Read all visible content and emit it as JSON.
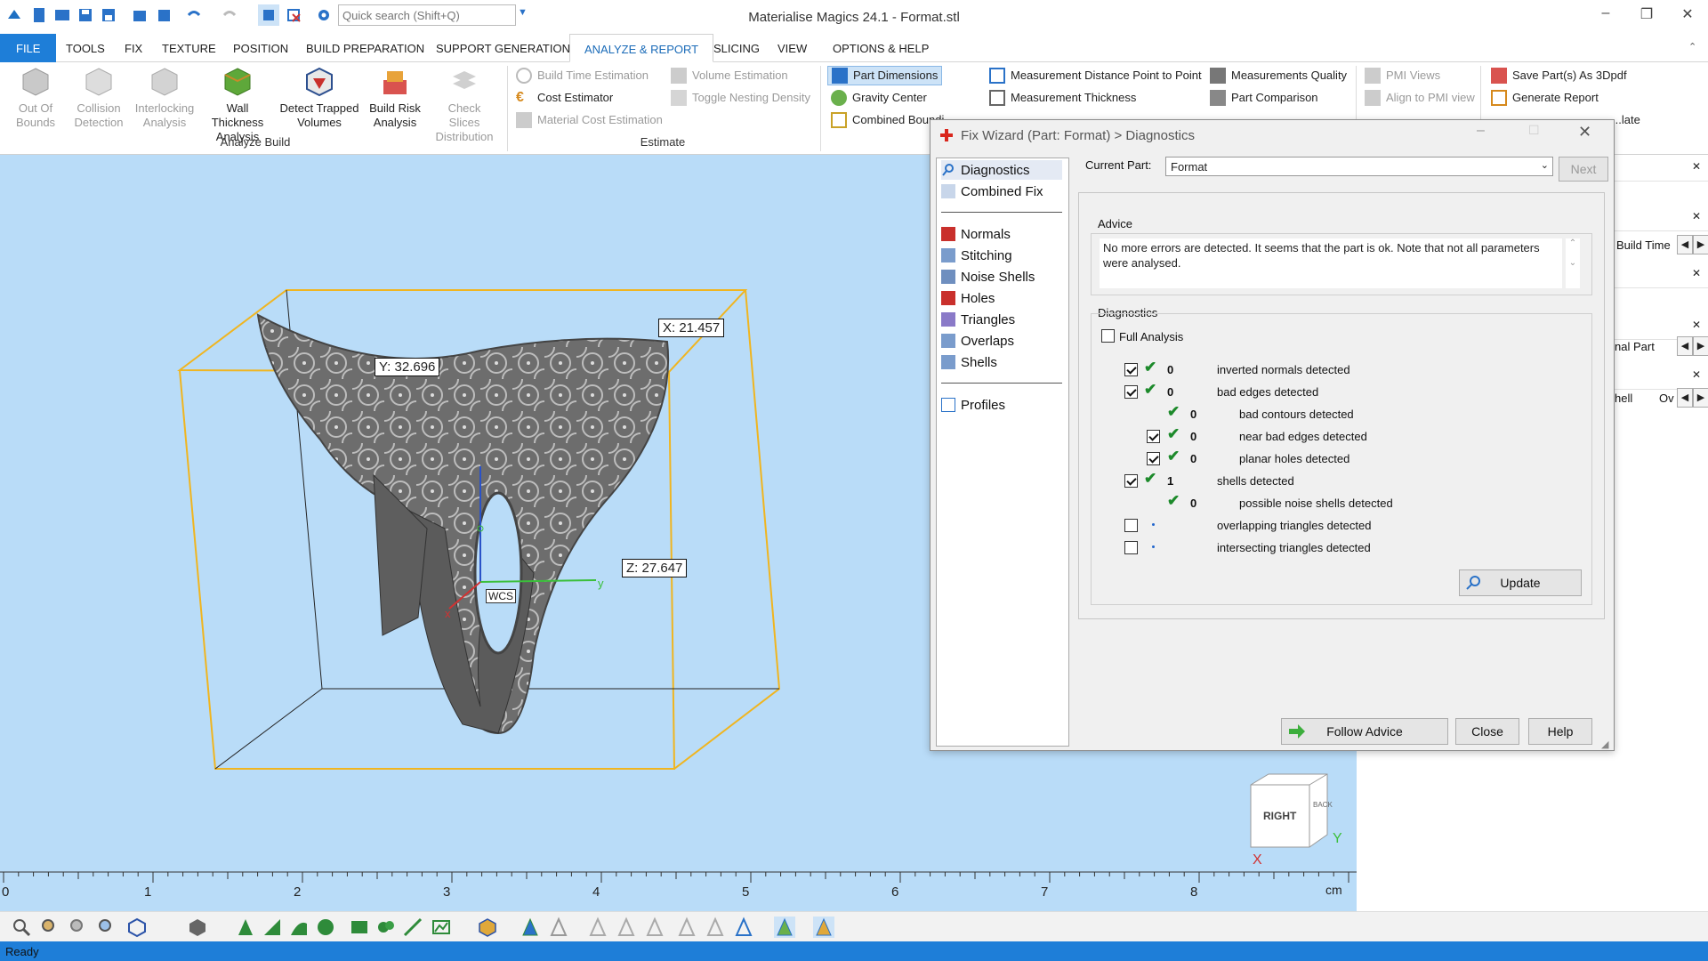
{
  "window": {
    "title": "Materialise Magics 24.1 - Format.stl",
    "min": "–",
    "restore": "❐",
    "close": "✕"
  },
  "quick_search": {
    "placeholder": "Quick search (Shift+Q)"
  },
  "menu": [
    "FILE",
    "TOOLS",
    "FIX",
    "TEXTURE",
    "POSITION",
    "BUILD PREPARATION",
    "SUPPORT GENERATION",
    "ANALYZE & REPORT",
    "SLICING",
    "VIEW",
    "OPTIONS & HELP"
  ],
  "ribbon": {
    "analyze_build": {
      "group": "Analyze Build",
      "items": [
        "Out Of Bounds",
        "Collision Detection",
        "Interlocking Analysis",
        "Wall Thickness Analysis",
        "Detect Trapped Volumes",
        "Build Risk Analysis",
        "Check Slices Distribution"
      ]
    },
    "estimate": {
      "group": "Estimate",
      "items": [
        "Build Time Estimation",
        "Cost Estimator",
        "Material Cost Estimation",
        "Volume Estimation",
        "Toggle Nesting Density"
      ]
    },
    "measure": [
      "Part Dimensions",
      "Gravity Center",
      "Combined Boundi",
      "Measurement Distance Point to Point",
      "Measurement Thickness",
      "Measurements Quality",
      "Part Comparison"
    ],
    "pmi": [
      "PMI Views",
      "Align to PMI view"
    ],
    "report": [
      "Save Part(s) As 3Dpdf",
      "Generate Report",
      "...late"
    ]
  },
  "viewport": {
    "labels": {
      "x": "X: 21.457",
      "y": "Y: 32.696",
      "z": "Z: 27.647",
      "wcs": "WCS",
      "axis_y": "y",
      "axis_x": "x"
    },
    "viewcube": {
      "face": "RIGHT",
      "side": "BACK",
      "x": "X",
      "y": "Y"
    }
  },
  "ruler": {
    "ticks": [
      "0",
      "1",
      "2",
      "3",
      "4",
      "5",
      "6",
      "7",
      "8"
    ],
    "unit": "cm"
  },
  "right_panel": [
    "Build Time",
    "nal Part",
    "hell",
    "Ov"
  ],
  "dialog": {
    "title": "Fix Wizard (Part: Format) > Diagnostics",
    "nav_top": [
      "Diagnostics",
      "Combined Fix"
    ],
    "nav_mid": [
      "Normals",
      "Stitching",
      "Noise Shells",
      "Holes",
      "Triangles",
      "Overlaps",
      "Shells"
    ],
    "nav_bottom": [
      "Profiles"
    ],
    "current_part_label": "Current Part:",
    "current_part_value": "Format",
    "next": "Next",
    "advice_title": "Advice",
    "advice_text": "No more errors are detected. It seems that the part is ok. Note that not all parameters were analysed.",
    "diag_title": "Diagnostics",
    "full_analysis": "Full Analysis",
    "rows": [
      {
        "count": "0",
        "label": "inverted normals detected"
      },
      {
        "count": "0",
        "label": "bad edges detected"
      },
      {
        "count": "0",
        "label": "bad contours detected"
      },
      {
        "count": "0",
        "label": "near bad edges detected"
      },
      {
        "count": "0",
        "label": "planar holes detected"
      },
      {
        "count": "1",
        "label": "shells detected"
      },
      {
        "count": "0",
        "label": "possible noise shells detected"
      },
      {
        "count": "",
        "label": "overlapping triangles detected"
      },
      {
        "count": "",
        "label": "intersecting triangles detected"
      }
    ],
    "update": "Update",
    "follow": "Follow Advice",
    "close": "Close",
    "help": "Help"
  },
  "status": "Ready"
}
